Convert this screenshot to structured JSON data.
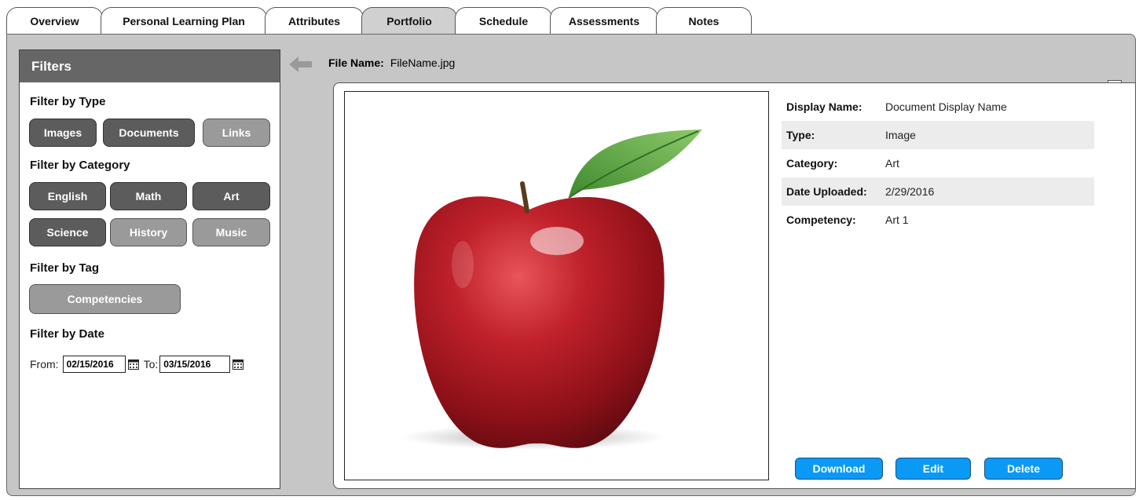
{
  "tabs": [
    {
      "label": "Overview"
    },
    {
      "label": "Personal Learning Plan"
    },
    {
      "label": "Attributes"
    },
    {
      "label": "Portfolio"
    },
    {
      "label": "Schedule"
    },
    {
      "label": "Assessments"
    },
    {
      "label": "Notes"
    }
  ],
  "active_tab": "Portfolio",
  "filters": {
    "title": "Filters",
    "type_label": "Filter by Type",
    "type_buttons": [
      "Images",
      "Documents",
      "Links"
    ],
    "category_label": "Filter by Category",
    "category_buttons": [
      "English",
      "Math",
      "Art",
      "Science",
      "History",
      "Music"
    ],
    "tag_label": "Filter by Tag",
    "tag_button": "Competencies",
    "date_label": "Filter by Date",
    "from_label": "From:",
    "from_value": "02/15/2016",
    "to_label": "To:",
    "to_value": "03/15/2016"
  },
  "file": {
    "name_label": "File Name:",
    "name_value": "FileName.jpg"
  },
  "details": [
    {
      "key": "Display Name:",
      "value": "Document Display Name"
    },
    {
      "key": "Type:",
      "value": "Image"
    },
    {
      "key": "Category:",
      "value": "Art"
    },
    {
      "key": "Date Uploaded:",
      "value": "2/29/2016"
    },
    {
      "key": "Competency:",
      "value": "Art 1"
    }
  ],
  "actions": {
    "download": "Download",
    "edit": "Edit",
    "delete": "Delete"
  },
  "colors": {
    "panel_bg": "#c6c6c6",
    "filters_header": "#666666",
    "pill_dark": "#5c5c5c",
    "pill_light": "#9a9a9a",
    "action_button": "#0a99f5"
  },
  "icons": {
    "back": "arrow-left-icon",
    "calendar": "calendar-icon",
    "preview": "apple-image"
  }
}
